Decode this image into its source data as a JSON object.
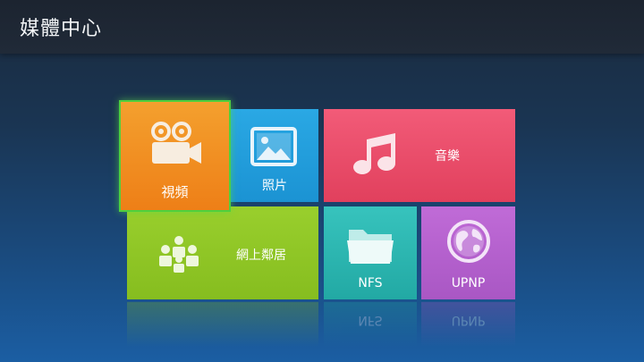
{
  "header": {
    "title": "媒體中心"
  },
  "tiles": {
    "video": {
      "label": "視頻",
      "icon": "video-camera-icon",
      "color": "#f08a1e",
      "focused": true
    },
    "photos": {
      "label": "照片",
      "icon": "picture-icon",
      "color": "#1f9ad8"
    },
    "music": {
      "label": "音樂",
      "icon": "music-note-icon",
      "color": "#e84a67"
    },
    "network": {
      "label": "網上鄰居",
      "icon": "people-group-icon",
      "color": "#8fc426"
    },
    "nfs": {
      "label": "NFS",
      "icon": "folder-icon",
      "color": "#2ab3ad"
    },
    "upnp": {
      "label": "UPNP",
      "icon": "globe-icon",
      "color": "#b460cc"
    }
  },
  "colors": {
    "focus_border": "#4fcf3e"
  }
}
